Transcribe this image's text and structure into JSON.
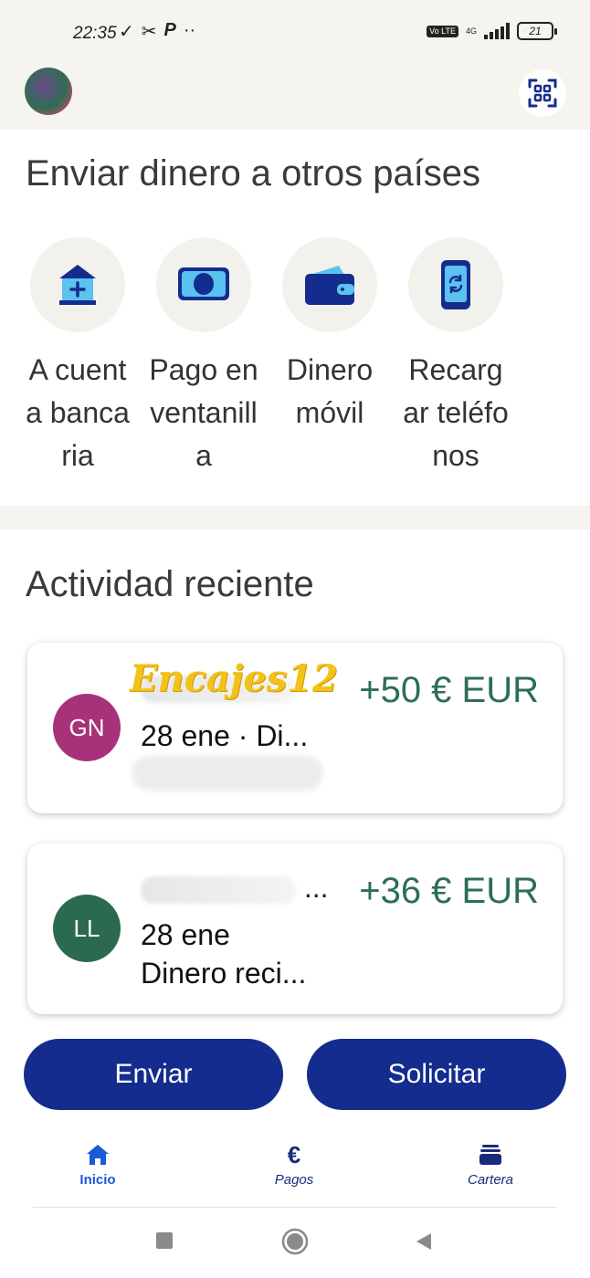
{
  "status_bar": {
    "time": "22:35",
    "network": "4G",
    "volte": "Vo LTE",
    "battery": "21",
    "left_icons": [
      "check-icon",
      "scissors-icon",
      "paypal-icon",
      "more-dots-icon"
    ]
  },
  "header": {
    "avatar": "profile-avatar",
    "qr_icon": "qr-scan-icon"
  },
  "send_abroad": {
    "title": "Enviar dinero a otros países",
    "options": [
      {
        "label": "A cuenta bancaria",
        "icon": "bank-icon"
      },
      {
        "label": "Pago en ventanilla",
        "icon": "cash-icon"
      },
      {
        "label": "Dinero móvil",
        "icon": "wallet-icon"
      },
      {
        "label": "Recargar teléfonos",
        "icon": "phone-refresh-icon"
      }
    ]
  },
  "recent": {
    "title": "Actividad reciente",
    "items": [
      {
        "initials": "GN",
        "name_visible": "",
        "amount": "+50 € EUR",
        "line1": "28 ene · Di...",
        "line2": "",
        "avatar_color": "#a83279",
        "watermark": "Encajes12"
      },
      {
        "initials": "LL",
        "name_visible": "...",
        "amount": "+36 € EUR",
        "line1": "28 ene",
        "line2": "Dinero reci...",
        "avatar_color": "#2b6a4f"
      }
    ]
  },
  "actions": {
    "send": "Enviar",
    "request": "Solicitar"
  },
  "bottom_nav": [
    {
      "label": "Inicio",
      "icon": "home-icon",
      "active": true
    },
    {
      "label": "Pagos",
      "icon": "euro-icon",
      "active": false
    },
    {
      "label": "Cartera",
      "icon": "wallet-cards-icon",
      "active": false
    }
  ],
  "colors": {
    "brand_blue": "#142c8e",
    "amount_green": "#2c6e57",
    "active_nav": "#1a5ad6",
    "background_beige": "#f5f4ef"
  }
}
